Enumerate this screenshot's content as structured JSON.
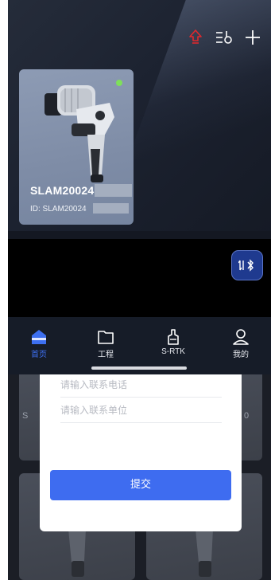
{
  "top_bar": {
    "icons": [
      "upgrade-arrow-icon",
      "filter-settings-icon",
      "add-icon"
    ]
  },
  "device_card": {
    "name": "SLAM20024",
    "id_label": "ID: SLAM20024",
    "status": "online",
    "status_color": "#7ee05a"
  },
  "bluetooth_button": {
    "icon": "bluetooth-switch-icon"
  },
  "tabbar": {
    "tabs": [
      {
        "label": "首页",
        "icon": "home-icon",
        "active": true
      },
      {
        "label": "工程",
        "icon": "folder-icon",
        "active": false
      },
      {
        "label": "S-RTK",
        "icon": "rtk-device-icon",
        "active": false
      },
      {
        "label": "我的",
        "icon": "user-icon",
        "active": false
      }
    ]
  },
  "modal_form": {
    "phone_placeholder": "请输入联系电话",
    "company_placeholder": "请输入联系单位",
    "submit_label": "提交"
  },
  "background_cards": {
    "left_peek": "S",
    "right_peek": "0"
  },
  "colors": {
    "accent": "#3e6cf0",
    "tab_active": "#3d6ff0",
    "upgrade_icon": "#e0282d"
  }
}
